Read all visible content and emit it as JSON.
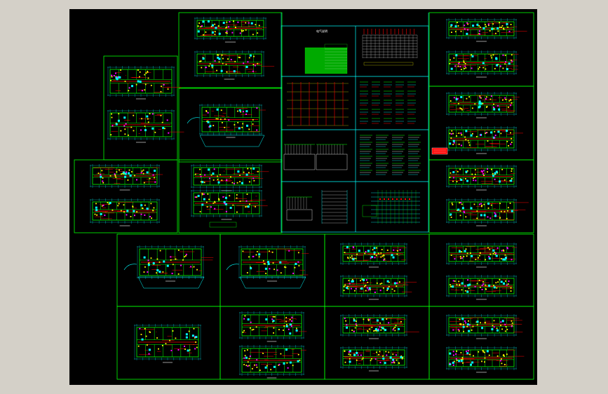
{
  "colors": {
    "background": "#000000",
    "frame": "#00ff00",
    "sheet_border": "#00ffff",
    "wall": "#00ff00",
    "furniture": "#ffff00",
    "electrical": "#ff0000",
    "dimension": "#00ffff",
    "text": "#ffffff",
    "legend_fill": "#00aa00",
    "stamp": "#ff0000"
  },
  "sheets": {
    "electrical_legend_title": "电气说明",
    "cover_note": "■ ■"
  }
}
